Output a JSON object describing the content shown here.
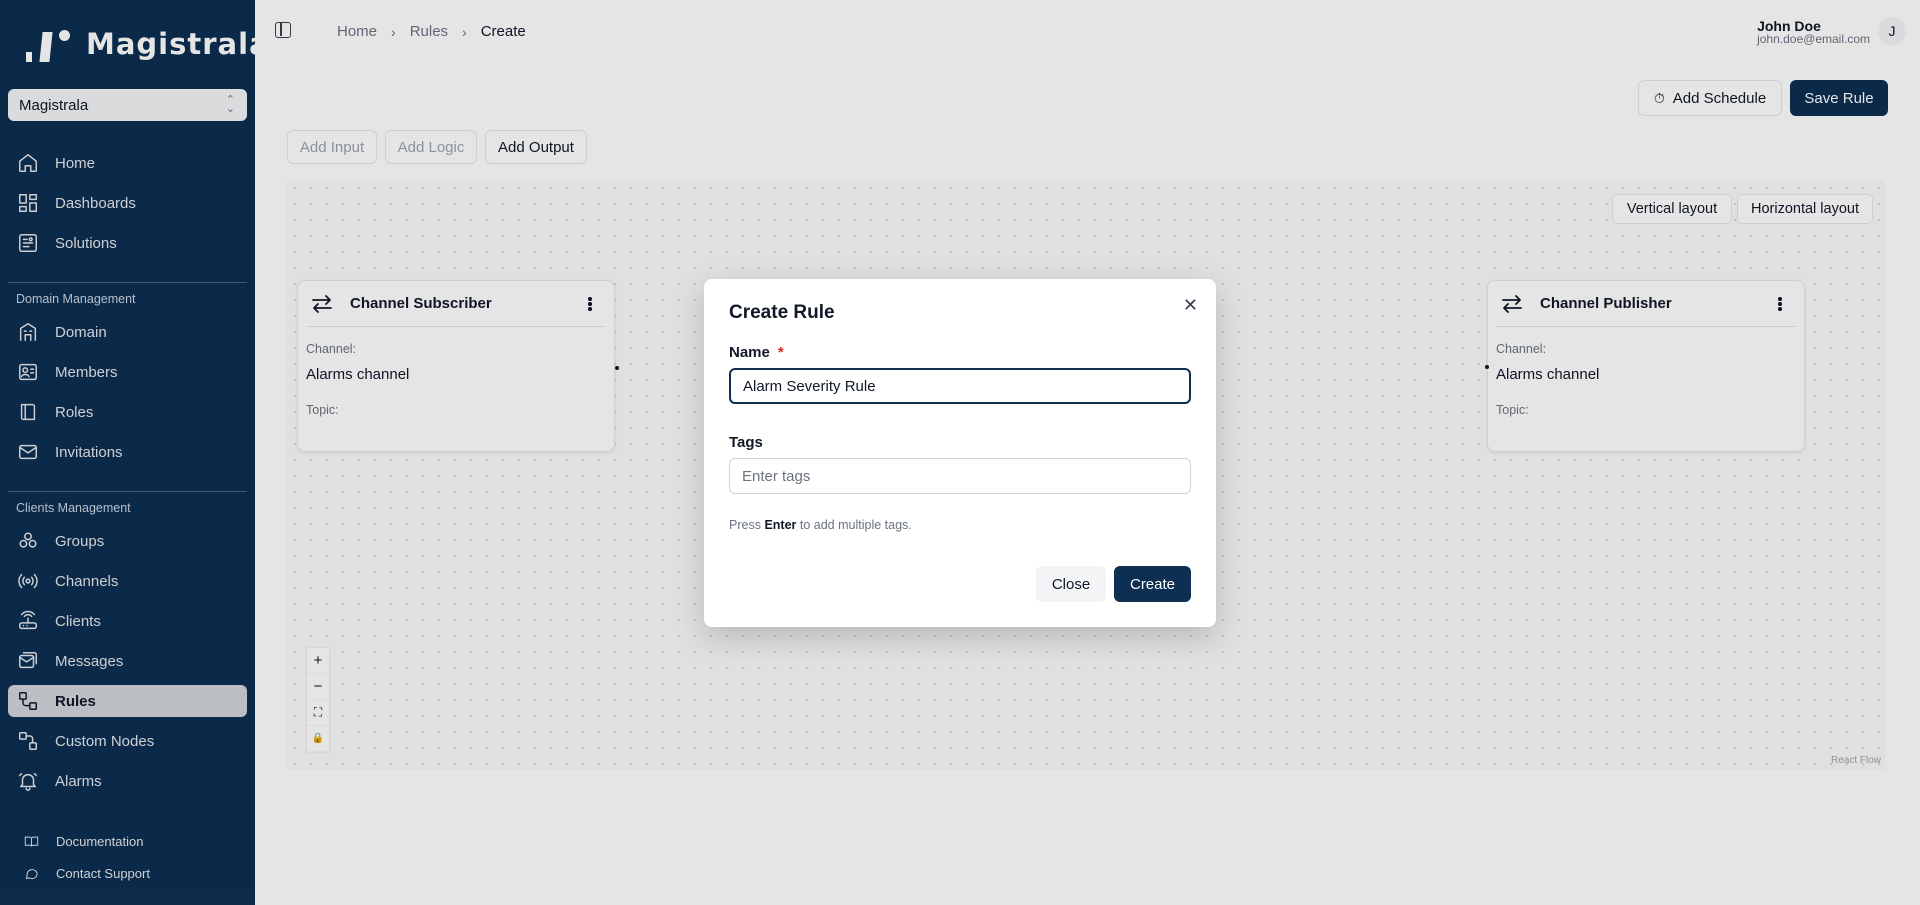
{
  "sidebar": {
    "logo_text": "Magistrala",
    "domain_selector": "Magistrala",
    "items_top": [
      {
        "label": "Home",
        "icon": "home-icon"
      },
      {
        "label": "Dashboards",
        "icon": "dashboard-icon"
      },
      {
        "label": "Solutions",
        "icon": "solutions-icon"
      }
    ],
    "domain_section": "Domain Management",
    "items_domain": [
      {
        "label": "Domain",
        "icon": "building-icon"
      },
      {
        "label": "Members",
        "icon": "members-icon"
      },
      {
        "label": "Roles",
        "icon": "book-icon"
      },
      {
        "label": "Invitations",
        "icon": "mail-icon"
      }
    ],
    "clients_section": "Clients Management",
    "items_clients": [
      {
        "label": "Groups",
        "icon": "groups-icon"
      },
      {
        "label": "Channels",
        "icon": "radio-icon"
      },
      {
        "label": "Clients",
        "icon": "router-icon"
      },
      {
        "label": "Messages",
        "icon": "messages-icon"
      },
      {
        "label": "Rules",
        "icon": "workflow-icon",
        "active": true
      },
      {
        "label": "Custom Nodes",
        "icon": "nodes-icon"
      },
      {
        "label": "Alarms",
        "icon": "bell-icon"
      }
    ],
    "footer": {
      "documentation": "Documentation",
      "support": "Contact Support"
    }
  },
  "header": {
    "breadcrumb": [
      "Home",
      "Rules",
      "Create"
    ],
    "user_name": "John Doe",
    "user_email": "john.doe@email.com",
    "avatar_initial": "J"
  },
  "toolbar": {
    "add_schedule": "Add Schedule",
    "save_rule": "Save Rule",
    "add_input": "Add Input",
    "add_logic": "Add Logic",
    "add_output": "Add Output"
  },
  "canvas": {
    "vertical_layout": "Vertical layout",
    "horizontal_layout": "Horizontal layout",
    "attribution": "React Flow",
    "controls": [
      "+",
      "−",
      "⛶",
      "🔒"
    ],
    "nodes": [
      {
        "title": "Channel Subscriber",
        "channel_label": "Channel:",
        "channel_value": "Alarms channel",
        "topic_label": "Topic:"
      },
      {
        "title": "Channel Publisher",
        "channel_label": "Channel:",
        "channel_value": "Alarms channel",
        "topic_label": "Topic:"
      }
    ]
  },
  "modal": {
    "title": "Create Rule",
    "name_label": "Name",
    "required_mark": "*",
    "name_value": "Alarm Severity Rule",
    "tags_label": "Tags",
    "tags_placeholder": "Enter tags",
    "hint_prefix": "Press",
    "hint_key": "Enter",
    "hint_suffix": "to add multiple tags.",
    "close_label": "Close",
    "create_label": "Create"
  },
  "colors": {
    "brand": "#0d2f52",
    "required": "#dc2626"
  }
}
